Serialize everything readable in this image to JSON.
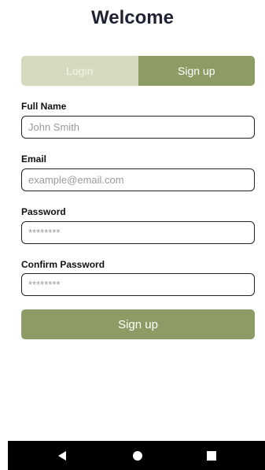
{
  "header": {
    "title": "Welcome"
  },
  "tabs": [
    {
      "label": "Login",
      "active": false
    },
    {
      "label": "Sign up",
      "active": true
    }
  ],
  "form": {
    "full_name": {
      "label": "Full Name",
      "placeholder": "John Smith",
      "value": ""
    },
    "email": {
      "label": "Email",
      "placeholder": "example@email.com",
      "value": ""
    },
    "password": {
      "label": "Password",
      "placeholder": "********",
      "value": ""
    },
    "confirm_password": {
      "label": "Confirm Password",
      "placeholder": "********",
      "value": ""
    },
    "submit_label": "Sign up"
  },
  "nav": {
    "back_icon": "back-triangle-icon",
    "home_icon": "home-circle-icon",
    "recents_icon": "recents-square-icon"
  },
  "colors": {
    "accent": "#8c9c64",
    "accent_light": "#d4d9c0",
    "title": "#1e2233"
  }
}
